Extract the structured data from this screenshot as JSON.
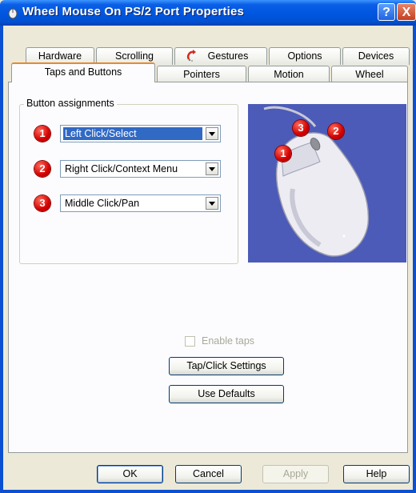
{
  "window": {
    "title": "Wheel Mouse On PS/2 Port Properties"
  },
  "title_buttons": {
    "help": "?",
    "close": "X"
  },
  "tabs_back": [
    {
      "label": "Hardware"
    },
    {
      "label": "Scrolling"
    },
    {
      "label": "Gestures"
    },
    {
      "label": "Options"
    },
    {
      "label": "Devices"
    }
  ],
  "tabs_front": [
    {
      "label": "Taps and Buttons",
      "active": true
    },
    {
      "label": "Pointers"
    },
    {
      "label": "Motion"
    },
    {
      "label": "Wheel"
    }
  ],
  "button_assignments": {
    "label": "Button assignments",
    "rows": [
      {
        "number": "1",
        "value": "Left Click/Select",
        "selected": true
      },
      {
        "number": "2",
        "value": "Right Click/Context Menu"
      },
      {
        "number": "3",
        "value": "Middle Click/Pan"
      }
    ]
  },
  "mouse_illustration": {
    "badges": [
      "1",
      "2",
      "3"
    ],
    "background_color": "#4c5bb8"
  },
  "enable_taps": {
    "label": "Enable taps",
    "checked": false,
    "enabled": false
  },
  "buttons": {
    "tap_click_settings": "Tap/Click Settings",
    "use_defaults": "Use Defaults"
  },
  "footer": {
    "ok": "OK",
    "cancel": "Cancel",
    "apply": "Apply",
    "help": "Help"
  },
  "colors": {
    "accent": "#0050d0",
    "badge": "#d40000",
    "selection": "#316ac5",
    "tab_highlight": "#e68b2c"
  }
}
